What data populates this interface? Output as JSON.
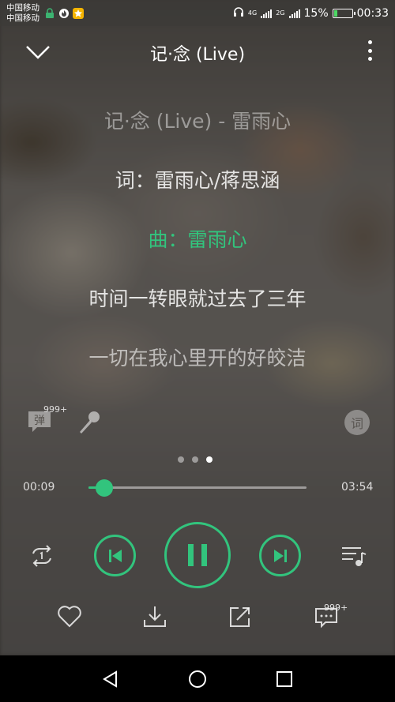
{
  "status_bar": {
    "carrier_1": "中国移动",
    "carrier_2": "中国移动",
    "signal_1_label": "4G",
    "signal_2_label": "2G",
    "battery": "15%",
    "time": "00:33"
  },
  "header": {
    "title": "记·念 (Live)"
  },
  "lyrics": {
    "line_1": "记·念 (Live) - 雷雨心",
    "line_2": "词：雷雨心/蒋思涵",
    "line_3": "曲：雷雨心",
    "line_4": "时间一转眼就过去了三年",
    "line_5": "一切在我心里开的好皎洁"
  },
  "tools": {
    "danmu_label": "弹",
    "danmu_count": "999+",
    "lyrics_label": "词"
  },
  "pager": {
    "count": 3,
    "active": 3
  },
  "progress": {
    "current": "00:09",
    "total": "03:54",
    "fraction": 0.038
  },
  "actions": {
    "comment_count": "999+"
  },
  "colors": {
    "accent": "#32c47d"
  }
}
